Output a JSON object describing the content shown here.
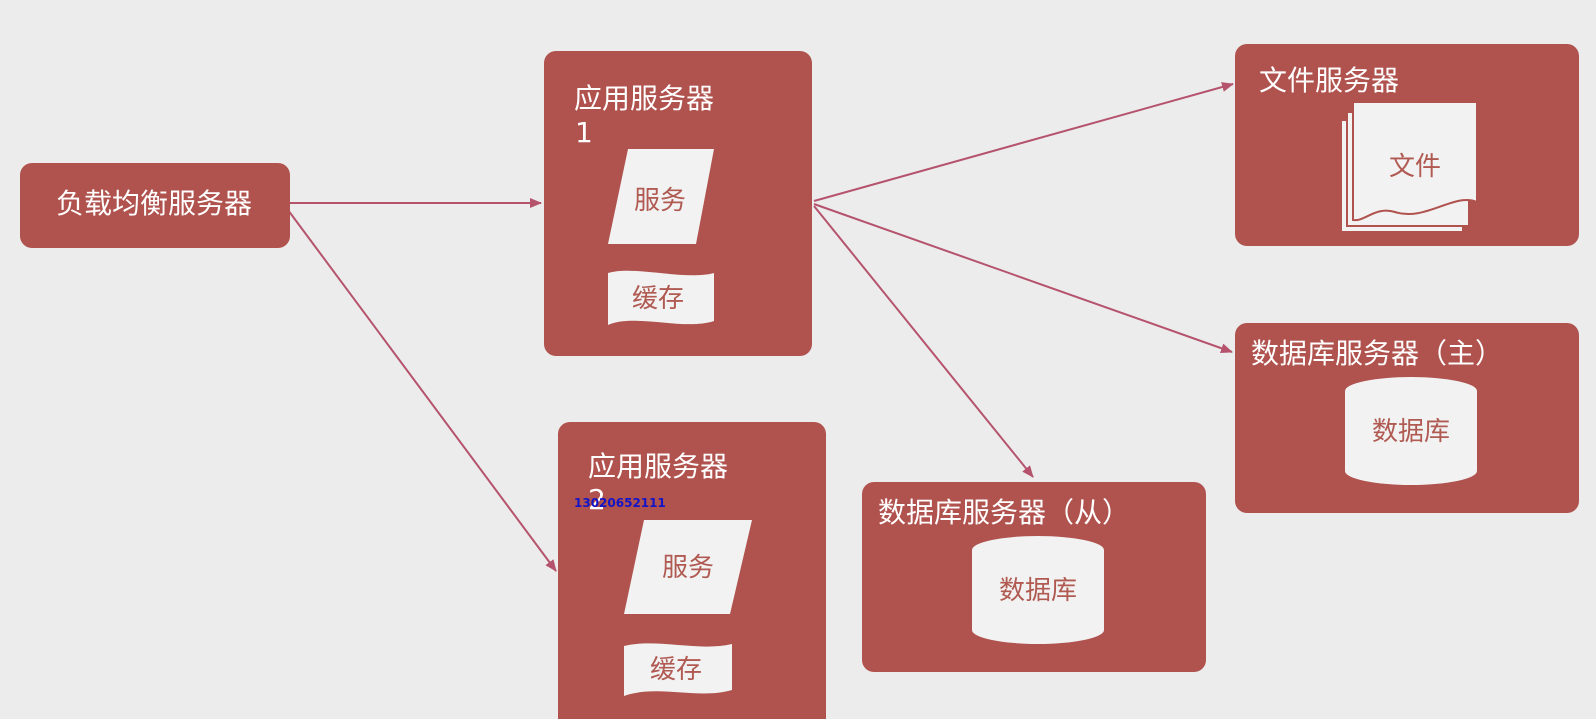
{
  "colors": {
    "box_fill": "#b0524d",
    "shape_fill": "#f2f2f2",
    "shape_text": "#b05a52",
    "arrow": "#b5536d",
    "background": "#ececec",
    "watermark": "#1414c8"
  },
  "nodes": {
    "load_balancer": {
      "label": "负载均衡服务器"
    },
    "app_server_1": {
      "title_line1": "应用服务器",
      "title_line2": "1",
      "service": "服务",
      "cache": "缓存"
    },
    "app_server_2": {
      "title_line1": "应用服务器",
      "title_line2": "2",
      "service": "服务",
      "cache": "缓存"
    },
    "file_server": {
      "title": "文件服务器",
      "file": "文件"
    },
    "db_master": {
      "title": "数据库服务器（主）",
      "db": "数据库"
    },
    "db_slave": {
      "title": "数据库服务器（从）",
      "db": "数据库"
    }
  },
  "edges": [
    {
      "from": "load_balancer",
      "to": "app_server_1"
    },
    {
      "from": "load_balancer",
      "to": "app_server_2"
    },
    {
      "from": "app_server_1",
      "to": "file_server"
    },
    {
      "from": "app_server_1",
      "to": "db_master"
    },
    {
      "from": "app_server_1",
      "to": "db_slave"
    }
  ],
  "watermark": "13020652111"
}
